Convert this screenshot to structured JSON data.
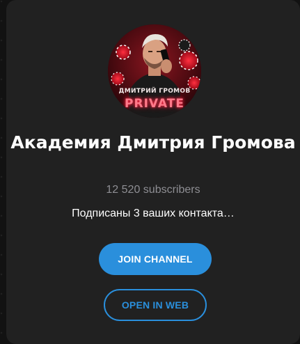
{
  "channel": {
    "title": "Академия Дмитрия Громова",
    "subscribers": "12 520 subscribers",
    "contacts": "Подписаны 3 ваших контакта…",
    "avatar_caption": "ДМИТРИЙ ГРОМОВ",
    "avatar_badge": "PRIVATE"
  },
  "buttons": {
    "join": "JOIN CHANNEL",
    "open_web": "OPEN IN WEB"
  },
  "colors": {
    "card": "#212121",
    "accent": "#2a8fdc",
    "secondary_text": "#8e8e93"
  }
}
